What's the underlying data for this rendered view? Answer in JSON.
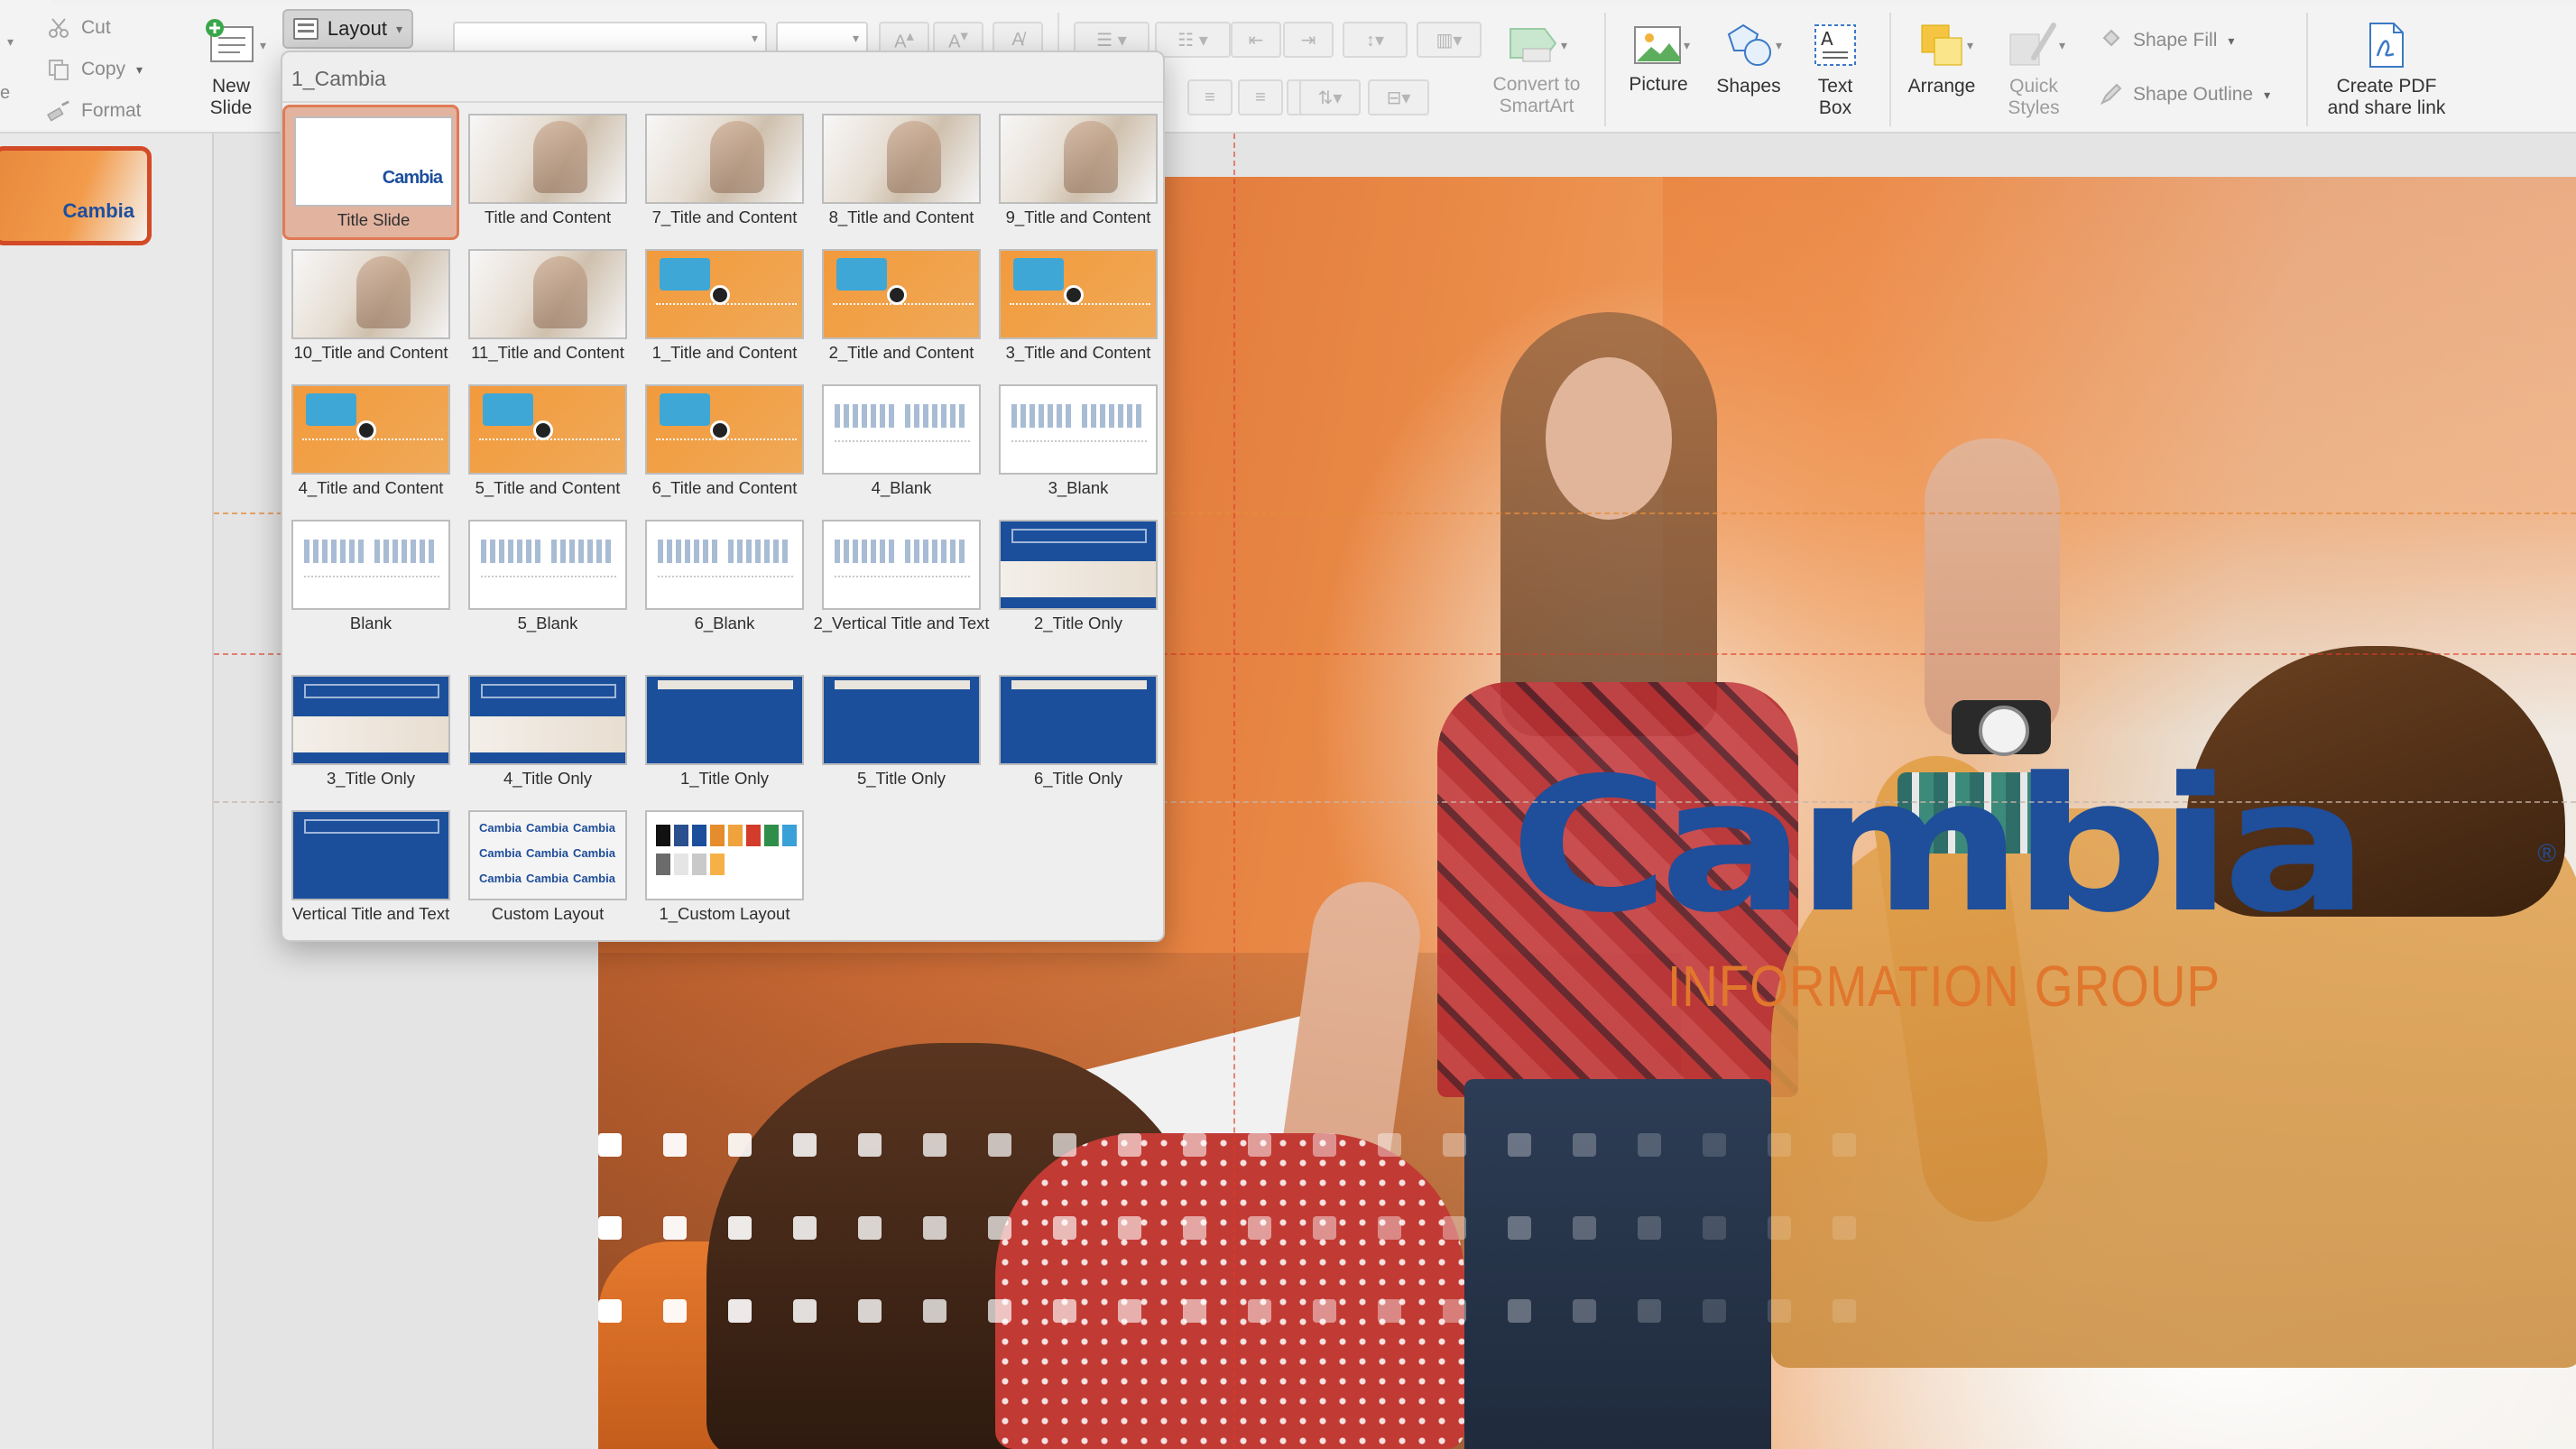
{
  "ribbon": {
    "clipboard": {
      "cut": "Cut",
      "copy": "Copy",
      "format": "Format"
    },
    "new_slide": "New\nSlide",
    "layout": "Layout",
    "convert_smartart": "Convert to\nSmartArt",
    "picture": "Picture",
    "shapes": "Shapes",
    "text_box": "Text\nBox",
    "arrange": "Arrange",
    "quick_styles": "Quick\nStyles",
    "shape_fill": "Shape Fill",
    "shape_outline": "Shape Outline",
    "create_pdf": "Create PDF\nand share link"
  },
  "gallery": {
    "header": "1_Cambia",
    "selected_index": 0,
    "layouts": [
      {
        "label": "Title Slide",
        "style": "title"
      },
      {
        "label": "Title and Content",
        "style": "photo"
      },
      {
        "label": "7_Title and Content",
        "style": "photo"
      },
      {
        "label": "8_Title and Content",
        "style": "photo"
      },
      {
        "label": "9_Title and Content",
        "style": "photo"
      },
      {
        "label": "10_Title and Content",
        "style": "photo"
      },
      {
        "label": "11_Title and Content",
        "style": "photo"
      },
      {
        "label": "1_Title and Content",
        "style": "orange"
      },
      {
        "label": "2_Title and Content",
        "style": "orange"
      },
      {
        "label": "3_Title and Content",
        "style": "orange"
      },
      {
        "label": "4_Title and Content",
        "style": "orange"
      },
      {
        "label": "5_Title and Content",
        "style": "orange"
      },
      {
        "label": "6_Title and Content",
        "style": "orange"
      },
      {
        "label": "4_Blank",
        "style": "blank"
      },
      {
        "label": "3_Blank",
        "style": "blank"
      },
      {
        "label": "Blank",
        "style": "blank"
      },
      {
        "label": "5_Blank",
        "style": "blank"
      },
      {
        "label": "6_Blank",
        "style": "blank"
      },
      {
        "label": "2_Vertical Title and Text",
        "style": "blank"
      },
      {
        "label": "2_Title Only",
        "style": "blue"
      },
      {
        "label": "3_Title Only",
        "style": "blue"
      },
      {
        "label": "4_Title Only",
        "style": "blue"
      },
      {
        "label": "1_Title Only",
        "style": "bluelow"
      },
      {
        "label": "5_Title Only",
        "style": "bluelow"
      },
      {
        "label": "6_Title Only",
        "style": "bluelow"
      },
      {
        "label": "Vertical Title and Text",
        "style": "bluefull"
      },
      {
        "label": "Custom Layout",
        "style": "custom"
      },
      {
        "label": "1_Custom Layout",
        "style": "swatches"
      }
    ]
  },
  "slide": {
    "logo_text": "Cambia",
    "logo_registered": "®",
    "logo_subtitle": "INFORMATION GROUP"
  },
  "thumbnail": {
    "logo_text": "Cambia"
  },
  "colors": {
    "brand_blue": "#1f4e9a",
    "brand_orange": "#e0772d",
    "selection": "#d24a26"
  },
  "icons": {
    "cut": "scissors-icon",
    "copy": "copy-icon",
    "format": "format-painter-icon",
    "new_slide": "new-slide-icon",
    "picture": "picture-icon",
    "shapes": "shapes-icon",
    "text_box": "text-box-icon",
    "arrange": "arrange-icon",
    "quick_styles": "quick-styles-icon",
    "shape_fill": "paint-bucket-icon",
    "shape_outline": "pen-icon",
    "create_pdf": "pdf-icon"
  }
}
